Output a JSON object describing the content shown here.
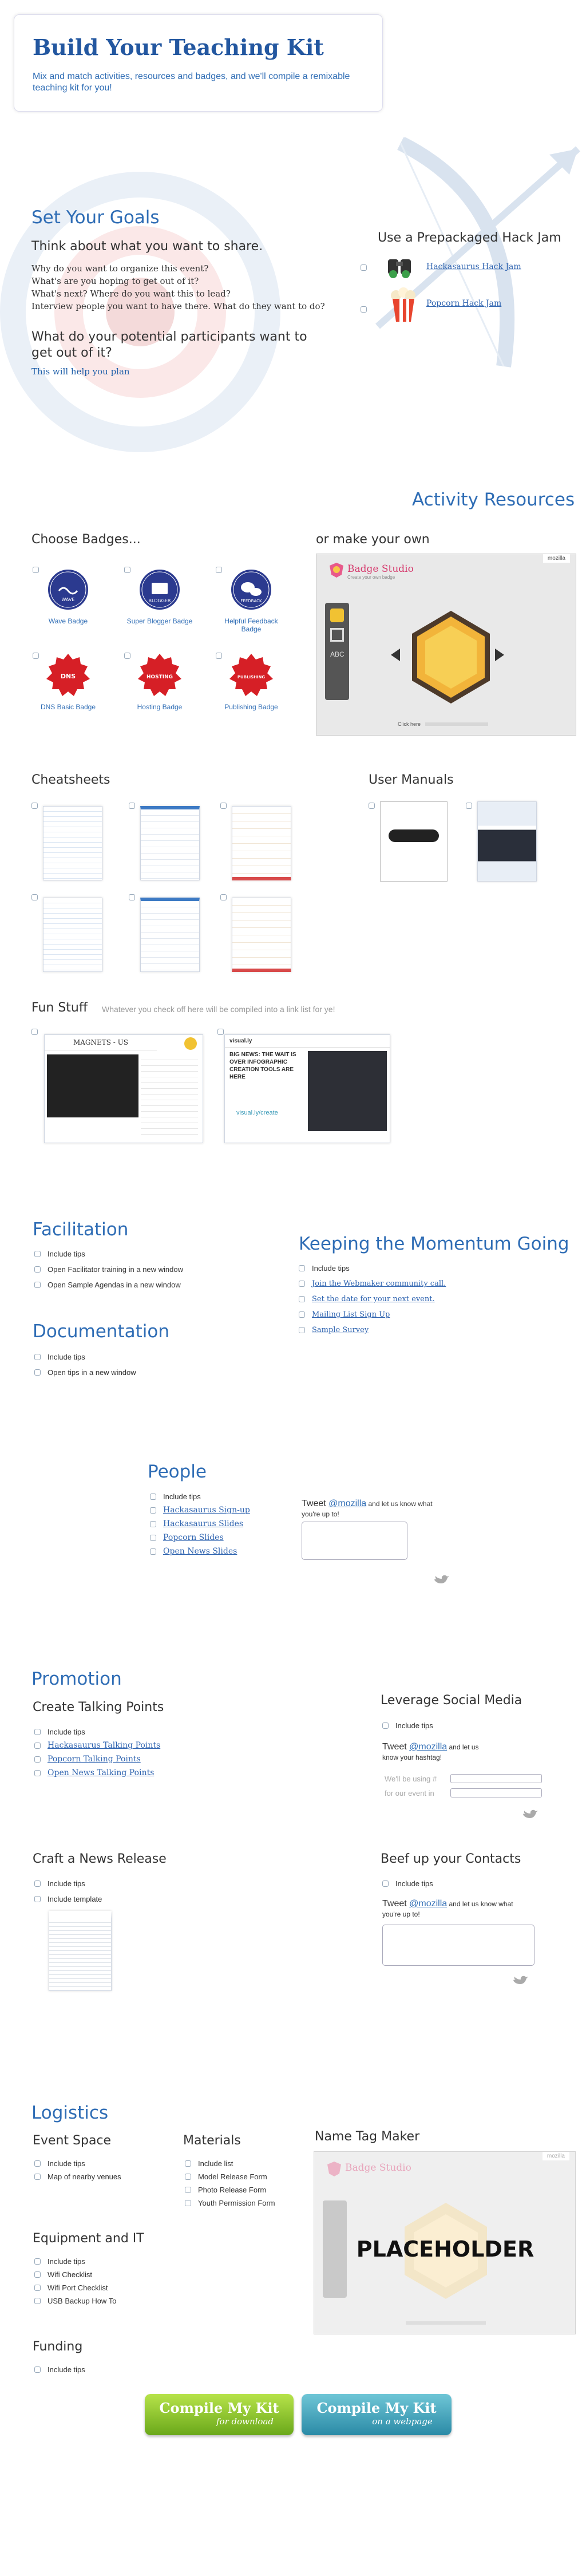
{
  "header": {
    "title": "Build Your Teaching Kit",
    "subtitle": "Mix and match activities, resources and badges, and we'll compile a remixable teaching kit for you!"
  },
  "goals": {
    "title": "Set Your Goals",
    "think_title": "Think about what you want to share.",
    "questions": [
      "Why do you want to organize this event?",
      "What's are you hoping to get out of it?",
      "What's next? Where do you want this to lead?",
      "Interview people you want to have there. What do they want to do?"
    ],
    "participants_title": "What do your potential participants want to get out of it?",
    "help_link": "This will help you plan",
    "hack_title": "Use a Prepackaged Hack Jam",
    "hack_items": [
      "Hackasaurus Hack Jam",
      "Popcorn Hack Jam"
    ]
  },
  "resources": {
    "title": "Activity Resources",
    "badges_title": "Choose Badges...",
    "make_own": "or make your own",
    "badges": [
      {
        "label": "Wave Badge",
        "icon": "WAVE",
        "color": "#2b3a8f"
      },
      {
        "label": "Super Blogger Badge",
        "icon": "BLOGGER",
        "color": "#2b3a8f"
      },
      {
        "label": "Helpful Feedback Badge",
        "icon": "FEEDBACK",
        "color": "#2b3a8f"
      },
      {
        "label": "DNS Basic Badge",
        "icon": "DNS",
        "color": "#d61f26"
      },
      {
        "label": "Hosting Badge",
        "icon": "HOSTING",
        "color": "#d61f26"
      },
      {
        "label": "Publishing Badge",
        "icon": "PUBLISHING",
        "color": "#d61f26"
      }
    ],
    "studio": {
      "name": "Badge Studio",
      "tagline": "Create your own badge",
      "mozilla": "mozilla",
      "click": "Click here"
    },
    "cheatsheets_title": "Cheatsheets",
    "manuals_title": "User Manuals",
    "fun_title": "Fun Stuff",
    "fun_note": "Whatever you check off here will be compiled into a link list for ye!",
    "fun_items": [
      {
        "header": "MAGNETS - US"
      },
      {
        "header": "visual.ly",
        "big": "BIG NEWS: THE WAIT IS OVER INFOGRAPHIC CREATION TOOLS ARE HERE",
        "sub": "visual.ly/create"
      }
    ]
  },
  "facilitation": {
    "title": "Facilitation",
    "items": [
      "Include tips",
      "Open Facilitator training in a new window",
      "Open Sample Agendas in a new window"
    ]
  },
  "documentation": {
    "title": "Documentation",
    "items": [
      "Include tips",
      "Open tips in a new window"
    ]
  },
  "momentum": {
    "title": "Keeping the Momentum Going",
    "tip": "Include tips",
    "links": [
      "Join the Webmaker community call.",
      "Set the date for your next event.",
      "Mailing List Sign Up",
      "Sample Survey"
    ]
  },
  "people": {
    "title": "People",
    "tip": "Include tips",
    "links": [
      "Hackasaurus Sign-up",
      "Hackasaurus Slides",
      "Popcorn Slides",
      "Open News Slides"
    ],
    "tweet_prefix": "Tweet ",
    "handle": "@mozilla",
    "tweet_suffix": " and let us know what you're up to!"
  },
  "promotion": {
    "title": "Promotion",
    "talking_title": "Create Talking Points",
    "talking_tip": "Include tips",
    "talking_links": [
      "Hackasaurus Talking Points",
      "Popcorn Talking Points",
      "Open News Talking Points"
    ],
    "social_title": "Leverage Social Media",
    "social_tip": "Include tips",
    "social_tweet_prefix": "Tweet ",
    "social_handle": "@mozilla",
    "social_tweet_suffix": " and let us know your hashtag!",
    "using_label": "We'll be using #",
    "event_label": "for our event in",
    "news_title": "Craft a News Release",
    "news_items": [
      "Include tips",
      "Include template"
    ],
    "contacts_title": "Beef up your Contacts",
    "contacts_tip": "Include tips",
    "contacts_tweet_prefix": "Tweet ",
    "contacts_handle": "@mozilla",
    "contacts_tweet_suffix": " and let us know what you're up to!"
  },
  "logistics": {
    "title": "Logistics",
    "event_space_title": "Event Space",
    "event_space_items": [
      "Include tips",
      "Map of nearby venues"
    ],
    "materials_title": "Materials",
    "materials_items": [
      "Include list",
      "Model Release Form",
      "Photo Release Form",
      "Youth Permission Form"
    ],
    "equipment_title": "Equipment and IT",
    "equipment_items": [
      "Include tips",
      "Wifi Checklist",
      "Wifi Port Checklist",
      "USB Backup How To"
    ],
    "funding_title": "Funding",
    "funding_items": [
      "Include tips"
    ],
    "nametag_title": "Name Tag Maker",
    "placeholder": "PLACEHOLDER",
    "nametag_studio": "Badge Studio",
    "nametag_mozilla": "mozilla"
  },
  "buttons": {
    "download_title": "Compile My Kit",
    "download_sub": "for download",
    "webpage_title": "Compile My Kit",
    "webpage_sub": "on a webpage"
  }
}
